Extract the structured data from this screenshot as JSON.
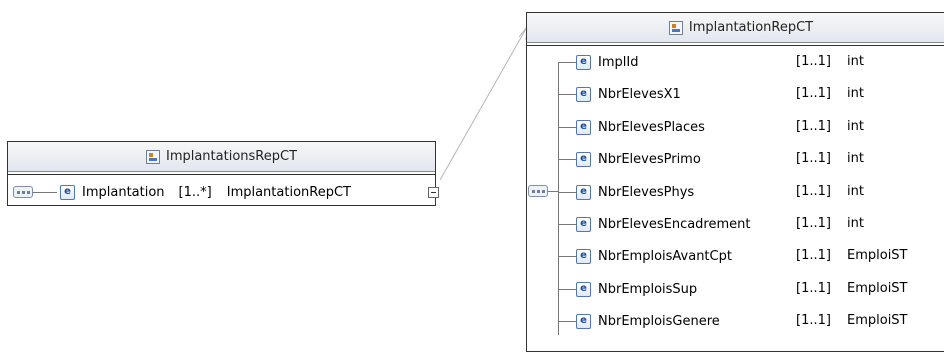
{
  "left_box": {
    "title": "ImplantationsRepCT",
    "element": {
      "name": "Implantation",
      "cardinality": "[1..*]",
      "type": "ImplantationRepCT"
    }
  },
  "right_box": {
    "title": "ImplantationRepCT",
    "elements": [
      {
        "name": "ImplId",
        "cardinality": "[1..1]",
        "type": "int"
      },
      {
        "name": "NbrElevesX1",
        "cardinality": "[1..1]",
        "type": "int"
      },
      {
        "name": "NbrElevesPlaces",
        "cardinality": "[1..1]",
        "type": "int"
      },
      {
        "name": "NbrElevesPrimo",
        "cardinality": "[1..1]",
        "type": "int"
      },
      {
        "name": "NbrElevesPhys",
        "cardinality": "[1..1]",
        "type": "int"
      },
      {
        "name": "NbrElevesEncadrement",
        "cardinality": "[1..1]",
        "type": "int"
      },
      {
        "name": "NbrEmploisAvantCpt",
        "cardinality": "[1..1]",
        "type": "EmploiST"
      },
      {
        "name": "NbrEmploisSup",
        "cardinality": "[1..1]",
        "type": "EmploiST"
      },
      {
        "name": "NbrEmploisGenere",
        "cardinality": "[1..1]",
        "type": "EmploiST"
      }
    ]
  },
  "icons": {
    "complex_type": "complex-type-icon",
    "element": "element-icon",
    "sequence": "sequence-icon",
    "collapse": "collapse-icon",
    "element_glyph": "e"
  },
  "colors": {
    "header_gradient_bottom": "#e2e7ee",
    "element_icon_text": "#1d4d98",
    "border": "#333333"
  }
}
